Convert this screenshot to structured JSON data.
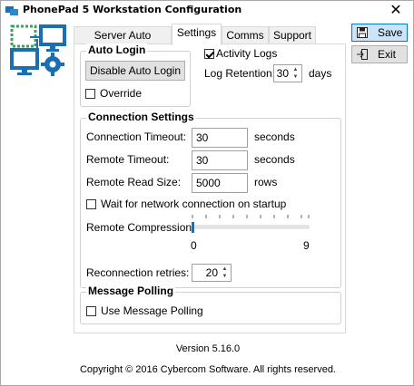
{
  "window": {
    "title": "PhonePad 5 Workstation Configuration"
  },
  "tabs": [
    {
      "label": "Server Auto Discovery",
      "active": false
    },
    {
      "label": "Settings",
      "active": true
    },
    {
      "label": "Comms",
      "active": false
    },
    {
      "label": "Support",
      "active": false
    }
  ],
  "actions": {
    "save_label": "Save",
    "exit_label": "Exit"
  },
  "auto_login": {
    "title": "Auto Login",
    "disable_button": "Disable Auto Login",
    "override_label": "Override",
    "override_checked": false
  },
  "activity": {
    "activity_logs_label": "Activity Logs",
    "activity_logs_checked": true,
    "log_retention_label": "Log Retention:",
    "log_retention_value": "30",
    "log_retention_unit": "days"
  },
  "connection": {
    "title": "Connection Settings",
    "connection_timeout_label": "Connection Timeout:",
    "connection_timeout_value": "30",
    "connection_timeout_unit": "seconds",
    "remote_timeout_label": "Remote Timeout:",
    "remote_timeout_value": "30",
    "remote_timeout_unit": "seconds",
    "remote_read_size_label": "Remote Read Size:",
    "remote_read_size_value": "5000",
    "remote_read_size_unit": "rows",
    "wait_label": "Wait for network connection on startup",
    "wait_checked": false,
    "compression_label": "Remote Compression:",
    "compression_min": "0",
    "compression_max": "9",
    "compression_value": 0,
    "reconnection_label": "Reconnection retries:",
    "reconnection_value": "20"
  },
  "polling": {
    "title": "Message Polling",
    "use_label": "Use Message Polling",
    "use_checked": false
  },
  "footer": {
    "version": "Version 5.16.0",
    "copyright": "Copyright © 2016 Cybercom Software. All rights reserved."
  },
  "colors": {
    "accent": "#0078d7",
    "logo_blue": "#1a6fb4",
    "logo_green": "#3aa35b"
  }
}
